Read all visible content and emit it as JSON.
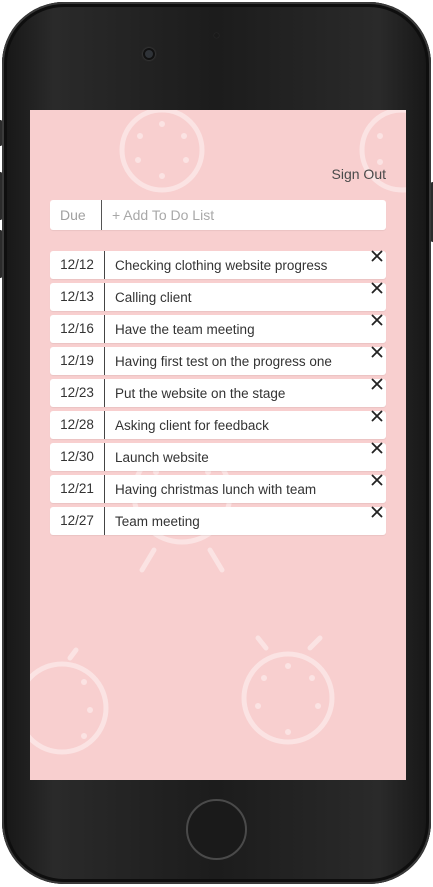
{
  "header": {
    "sign_out_label": "Sign Out"
  },
  "add_bar": {
    "due_label": "Due",
    "placeholder": "+ Add To Do List",
    "value": ""
  },
  "todos": [
    {
      "date": "12/12",
      "text": "Checking clothing website progress"
    },
    {
      "date": "12/13",
      "text": "Calling client"
    },
    {
      "date": "12/16",
      "text": "Have the team meeting"
    },
    {
      "date": "12/19",
      "text": "Having first test on the progress one"
    },
    {
      "date": "12/23",
      "text": "Put the website on the stage"
    },
    {
      "date": "12/28",
      "text": "Asking client for feedback"
    },
    {
      "date": "12/30",
      "text": "Launch website"
    },
    {
      "date": "12/21",
      "text": "Having christmas lunch with team"
    },
    {
      "date": "12/27",
      "text": "Team meeting"
    }
  ],
  "icons": {
    "delete": "close-icon",
    "background": "alarm-clock-icon"
  },
  "colors": {
    "screen_background": "#f8cfcf",
    "card_background": "#ffffff",
    "text": "#333333",
    "phone_body": "#1c1c1c"
  }
}
